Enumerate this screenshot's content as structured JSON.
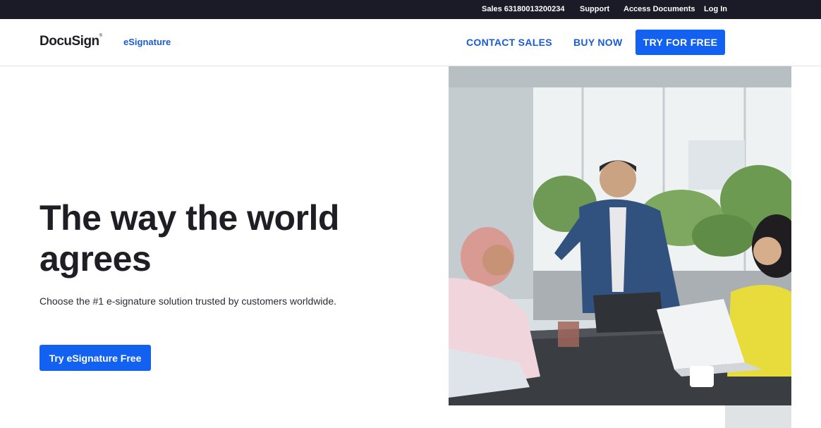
{
  "topbar": {
    "sales": "Sales 63180013200234",
    "support": "Support",
    "access_documents": "Access Documents",
    "login": "Log In"
  },
  "nav": {
    "logo": "DocuSign",
    "product": "eSignature",
    "contact_sales": "CONTACT SALES",
    "buy_now": "BUY NOW",
    "try_free": "TRY FOR FREE"
  },
  "hero": {
    "title": "The way the world agrees",
    "subtitle": "Choose the #1 e-signature solution trusted by customers worldwide.",
    "cta": "Try eSignature Free"
  },
  "colors": {
    "topbar_bg": "#1b1b28",
    "accent": "#1361f0",
    "link": "#1a5bd6"
  }
}
